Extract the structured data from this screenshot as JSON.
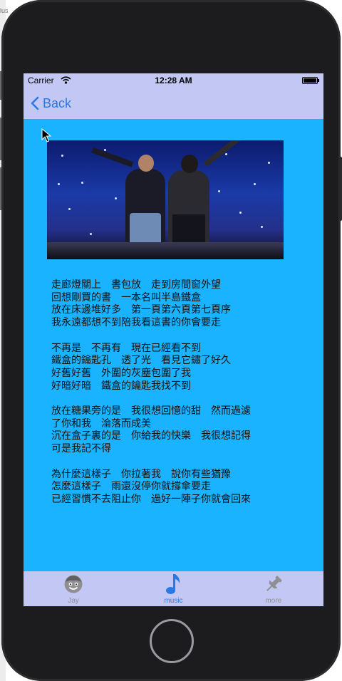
{
  "window_edge": {
    "text": "lus"
  },
  "status_bar": {
    "carrier": "Carrier",
    "time": "12:28 AM",
    "battery_level": 0.9
  },
  "nav": {
    "back_label": "Back"
  },
  "content": {
    "image_alt": "concert-photo",
    "lyrics": [
      "走廊燈關上　書包放　走到房間窗外望\n回想剛買的書　一本名叫半島鐵盒\n放在床邊堆好多　第一頁第六頁第七頁序\n我永遠都想不到陪我看這書的你會要走",
      "不再是　不再有　現在已經看不到\n鐵盒的鑰匙孔　透了光　看見它鏽了好久\n好舊好舊　外圍的灰塵包圍了我\n好暗好暗　鐵盒的鑰匙我找不到",
      "放在糖果旁的是　我很想回憶的甜　然而過濾\n了你和我　淪落而成美\n沉在盒子裏的是　你給我的快樂　我很想記得\n可是我記不得",
      "為什麼這樣子　你拉著我　說你有些猶豫\n怎麼這樣子　雨還沒停你就撐傘要走\n已經習慣不去阻止你　過好一陣子你就會回來"
    ]
  },
  "tabbar": {
    "items": [
      {
        "label": "Jay",
        "icon": "face-icon",
        "active": false
      },
      {
        "label": "music",
        "icon": "music-note-icon",
        "active": true
      },
      {
        "label": "more",
        "icon": "pin-icon",
        "active": false
      }
    ]
  },
  "colors": {
    "bars": "#c2c8f3",
    "content_bg": "#1ab3ff",
    "accent": "#2b78e4",
    "inactive": "#8e8e93"
  }
}
